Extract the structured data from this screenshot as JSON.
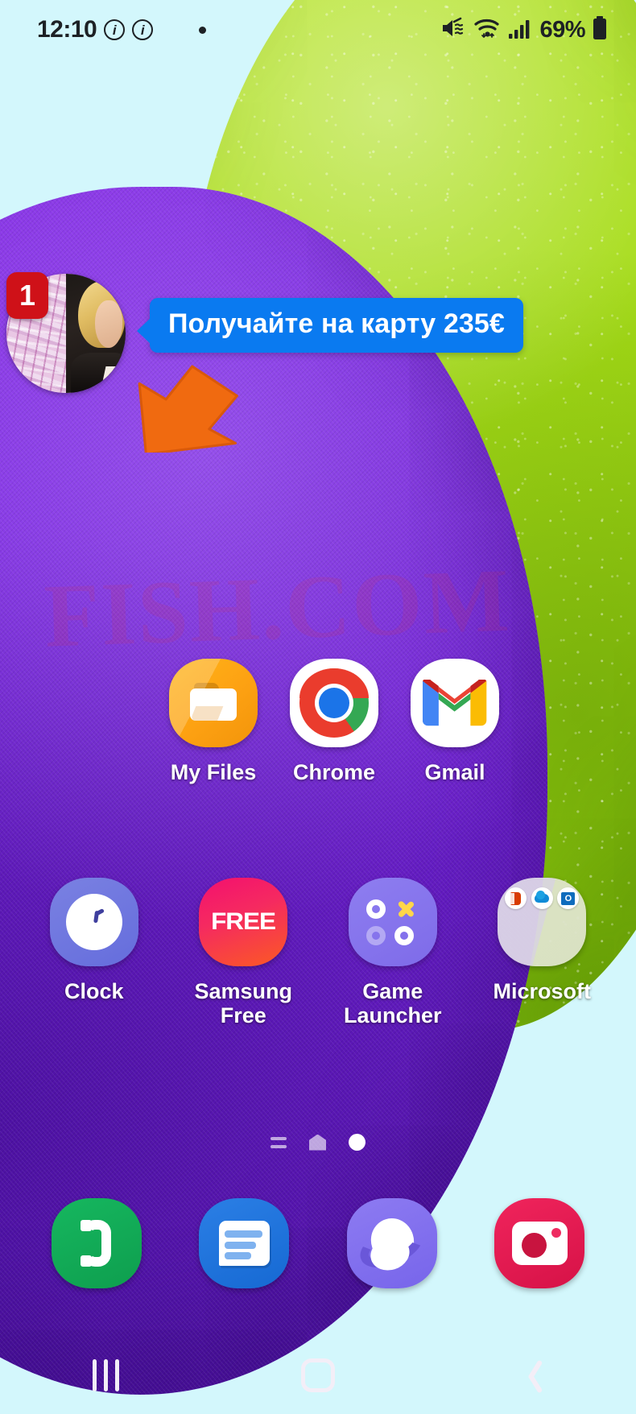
{
  "status_bar": {
    "time": "12:10",
    "info_icon_1": "info-circle-icon",
    "info_icon_2": "info-circle-icon",
    "notification_dot": "notification-dot",
    "mute_icon": "sound-mute-vibrate-icon",
    "wifi_icon": "wifi-icon",
    "signal_icon": "cellular-signal-icon",
    "battery_percent": "69%",
    "battery_icon": "battery-icon"
  },
  "notification": {
    "badge_count": "1",
    "bubble_text": "Получайте на карту 235€",
    "avatar": "contact-avatar",
    "pointer": "orange-pointer-arrow",
    "accent_color": "#0a7af0",
    "badge_color": "#cf1118",
    "pointer_color": "#f06a10"
  },
  "wallpaper": {
    "watermark_text": "FISH.COM",
    "sky_color": "#d3f7fc",
    "green_color": "#a6dc18",
    "purple_color": "#7b27e0"
  },
  "app_grid": {
    "rows": [
      {
        "apps": [
          {
            "label": "My Files",
            "icon": "my-files-icon"
          },
          {
            "label": "Chrome",
            "icon": "chrome-icon"
          },
          {
            "label": "Gmail",
            "icon": "gmail-icon"
          }
        ]
      },
      {
        "apps": [
          {
            "label": "Clock",
            "icon": "clock-icon"
          },
          {
            "label": "Samsung Free",
            "icon": "samsung-free-icon",
            "icon_text": "FREE"
          },
          {
            "label": "Game Launcher",
            "icon": "game-launcher-icon"
          },
          {
            "label": "Microsoft",
            "icon": "microsoft-folder-icon"
          }
        ]
      }
    ]
  },
  "page_indicator": {
    "items": [
      {
        "type": "apps-list-icon",
        "active": false
      },
      {
        "type": "home-page-icon",
        "active": false
      },
      {
        "type": "page-dot",
        "active": true
      }
    ]
  },
  "dock": {
    "apps": [
      {
        "label": "Phone",
        "icon": "phone-icon"
      },
      {
        "label": "Messages",
        "icon": "messages-icon"
      },
      {
        "label": "Samsung Internet",
        "icon": "samsung-internet-icon"
      },
      {
        "label": "Camera",
        "icon": "camera-icon"
      }
    ]
  },
  "nav_bar": {
    "recents_label": "Recents",
    "home_label": "Home",
    "back_label": "Back"
  }
}
